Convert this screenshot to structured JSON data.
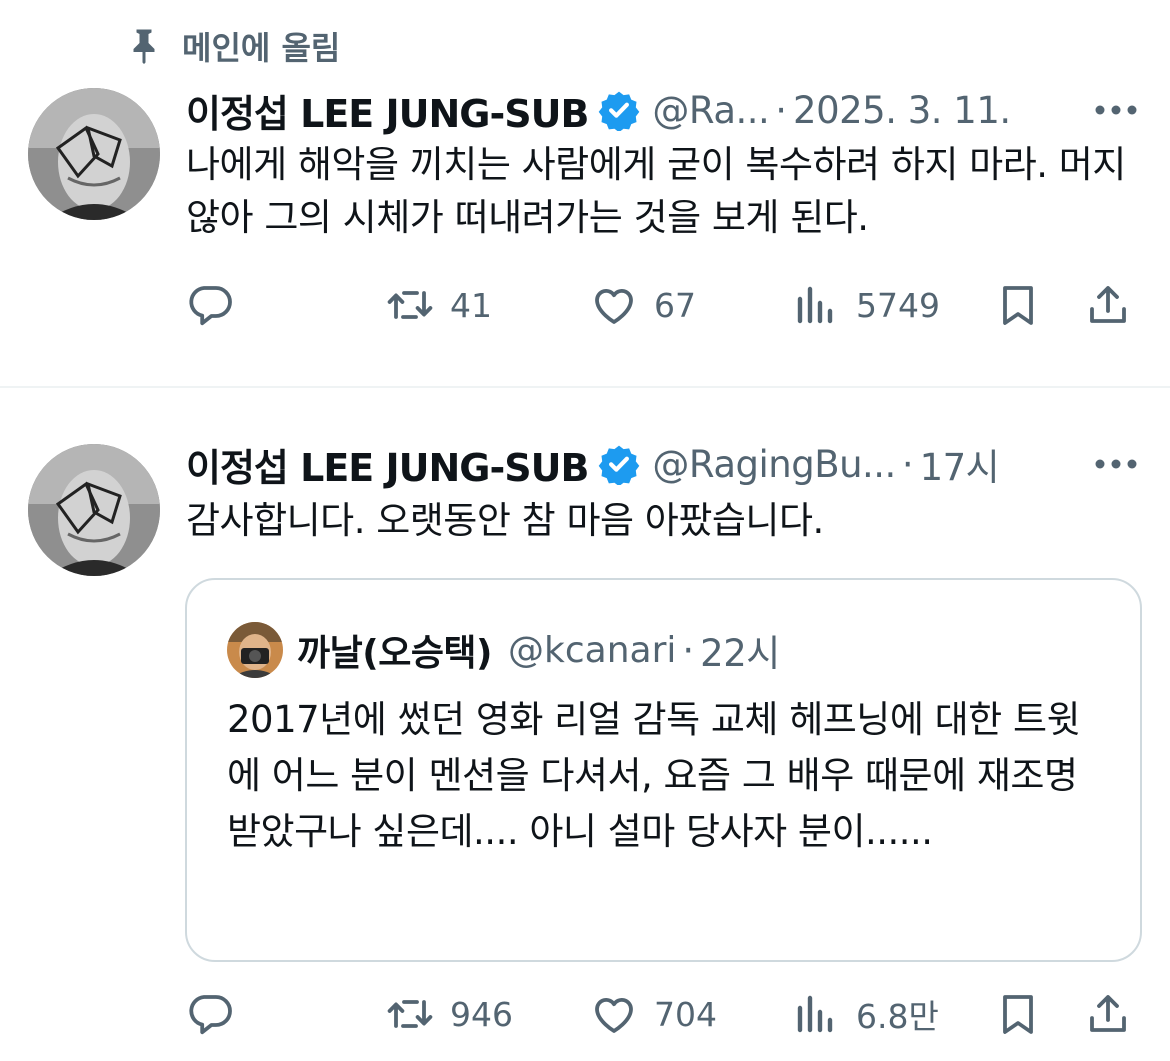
{
  "pinned": {
    "icon": "pin-icon",
    "label": "메인에 올림"
  },
  "tweets": [
    {
      "author_name": "이정섭 LEE JUNG-SUB",
      "handle": "@Ra...",
      "dot": "·",
      "time": "2025. 3. 11.",
      "text": "나에게 해악을 끼치는 사람에게 굳이 복수하려 하지 마라. 머지않아 그의 시체가 떠내려가는 것을 보게 된다.",
      "replies": "",
      "retweets": "41",
      "likes": "67",
      "views": "5749"
    },
    {
      "author_name": "이정섭 LEE JUNG-SUB",
      "handle": "@RagingBu...",
      "dot": "·",
      "time": "17시",
      "text": "감사합니다. 오랫동안 참 마음 아팠습니다.",
      "replies": "",
      "retweets": "946",
      "likes": "704",
      "views": "6.8만",
      "quote": {
        "author_name": "까날(오승택)",
        "handle": "@kcanari",
        "dot": "·",
        "time": "22시",
        "text": "2017년에 썼던 영화 리얼 감독 교체 헤프닝에 대한 트윗에 어느 분이 멘션을 다셔서, 요즘 그 배우 때문에 재조명 받았구나 싶은데.... 아니 설마 당사자 분이......"
      }
    }
  ],
  "colors": {
    "text_primary": "#0f1419",
    "text_secondary": "#536471",
    "verified_blue": "#1d9bf0",
    "border": "#cfd9de",
    "divider": "#eff3f4"
  },
  "icons": [
    "pin-icon",
    "verified-badge-icon",
    "more-icon",
    "reply-icon",
    "retweet-icon",
    "like-icon",
    "views-icon",
    "bookmark-icon",
    "share-icon"
  ]
}
